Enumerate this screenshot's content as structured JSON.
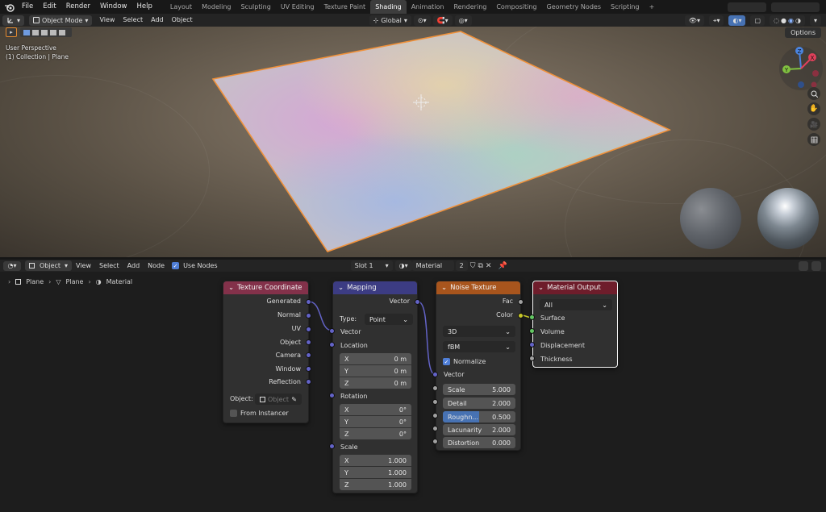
{
  "topbar": {
    "menus": [
      "File",
      "Edit",
      "Render",
      "Window",
      "Help"
    ],
    "workspaces": [
      "Layout",
      "Modeling",
      "Sculpting",
      "UV Editing",
      "Texture Paint",
      "Shading",
      "Animation",
      "Rendering",
      "Compositing",
      "Geometry Nodes",
      "Scripting"
    ],
    "active_workspace": "Shading",
    "add_tab": "+"
  },
  "viewport_header": {
    "mode": "Object Mode",
    "menus": [
      "View",
      "Select",
      "Add",
      "Object"
    ],
    "orientation": "Global",
    "options": "Options"
  },
  "viewport": {
    "perspective": "User Perspective",
    "collection": "(1) Collection | Plane",
    "gizmo": {
      "x": "X",
      "y": "Y",
      "z": "Z"
    }
  },
  "node_header": {
    "type": "Object",
    "menus": [
      "View",
      "Select",
      "Add",
      "Node"
    ],
    "use_nodes": "Use Nodes",
    "slot": "Slot 1",
    "material": "Material",
    "users": "2"
  },
  "breadcrumb": {
    "items": [
      "Plane",
      "Plane",
      "Material"
    ]
  },
  "nodes": {
    "texcoord": {
      "title": "Texture Coordinate",
      "outputs": [
        "Generated",
        "Normal",
        "UV",
        "Object",
        "Camera",
        "Window",
        "Reflection"
      ],
      "object_label": "Object:",
      "object_placeholder": "Object",
      "from_instancer": "From Instancer"
    },
    "mapping": {
      "title": "Mapping",
      "out": "Vector",
      "type_label": "Type:",
      "type_value": "Point",
      "in_vector": "Vector",
      "location": "Location",
      "rotation": "Rotation",
      "scale": "Scale",
      "loc": [
        [
          "X",
          "0 m"
        ],
        [
          "Y",
          "0 m"
        ],
        [
          "Z",
          "0 m"
        ]
      ],
      "rot": [
        [
          "X",
          "0°"
        ],
        [
          "Y",
          "0°"
        ],
        [
          "Z",
          "0°"
        ]
      ],
      "scl": [
        [
          "X",
          "1.000"
        ],
        [
          "Y",
          "1.000"
        ],
        [
          "Z",
          "1.000"
        ]
      ]
    },
    "noise": {
      "title": "Noise Texture",
      "fac": "Fac",
      "color": "Color",
      "dims": "3D",
      "type": "fBM",
      "normalize": "Normalize",
      "vector": "Vector",
      "params": [
        [
          "Scale",
          "5.000"
        ],
        [
          "Detail",
          "2.000"
        ],
        [
          "Roughn...",
          "0.500"
        ],
        [
          "Lacunarity",
          "2.000"
        ],
        [
          "Distortion",
          "0.000"
        ]
      ]
    },
    "output": {
      "title": "Material Output",
      "target": "All",
      "inputs": [
        "Surface",
        "Volume",
        "Displacement",
        "Thickness"
      ]
    }
  },
  "colors": {
    "texcoord_hdr": "#83314a",
    "mapping_hdr": "#3c3c83",
    "noise_hdr": "#a8551d",
    "output_hdr": "#6e1d2b",
    "vector_socket": "#6363c7",
    "color_socket": "#c7c729",
    "shader_socket": "#63c763",
    "grey_socket": "#a1a1a1",
    "selected_outline": "#f5f5f5",
    "accent": "#4772b3"
  }
}
